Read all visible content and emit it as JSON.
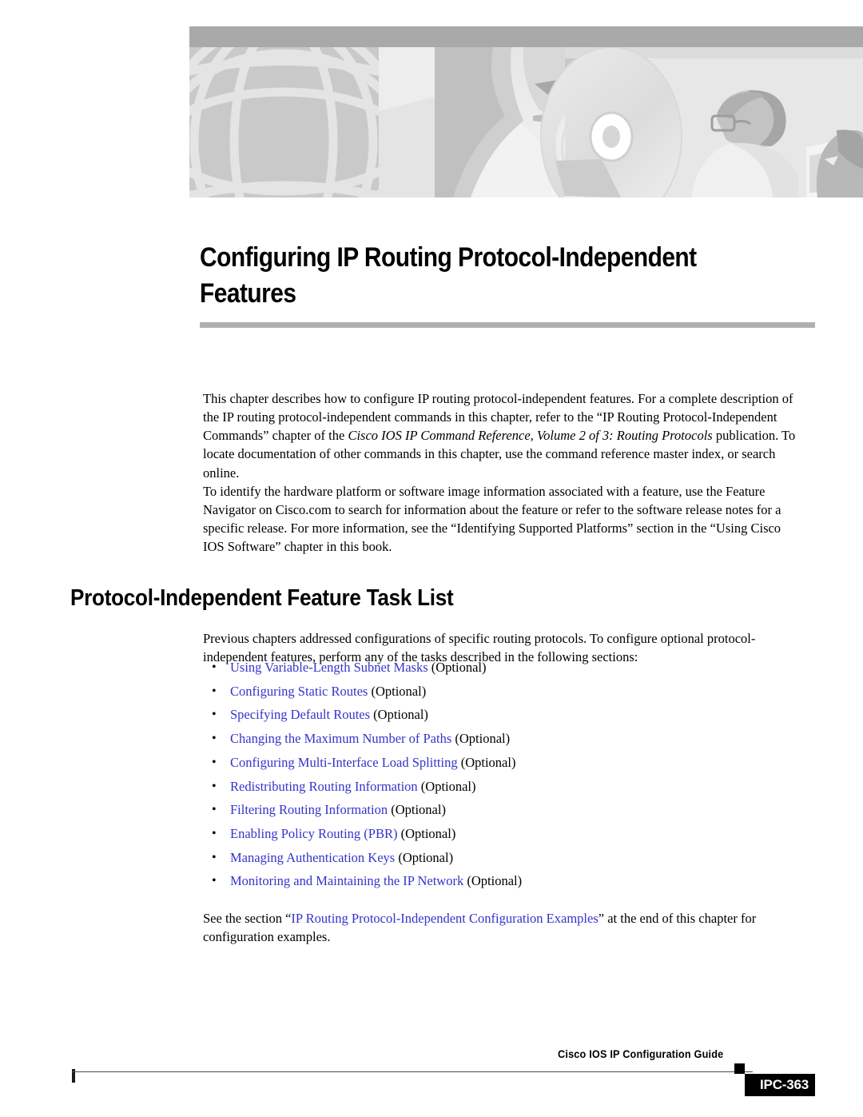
{
  "banner": {
    "alt": "cisco-chapter-banner-illustration",
    "elements": [
      "globe-wireframe",
      "face-profile",
      "compact-disc",
      "person-with-glasses-at-monitor",
      "person-silhouette"
    ],
    "colors": {
      "band_top": "#a9a9a9",
      "background": "#d3d3d3",
      "light": "#e8e8e8",
      "mid": "#c4c4c4"
    }
  },
  "chapter": {
    "title": "Configuring IP Routing Protocol-Independent Features",
    "rule_color": "#b0b0b0"
  },
  "intro": {
    "para1_a": "This chapter describes how to configure IP routing protocol-independent features. For a complete description of the IP routing protocol-independent commands in this chapter, refer to the “IP Routing Protocol-Independent Commands” chapter of the ",
    "para1_italic1": "Cisco IOS IP Command Reference, Volume 2 of 3: Routing Protocols",
    "para1_b": " publication. To locate documentation of other commands in this chapter, use the command reference master index, or search online.",
    "para2": "To identify the hardware platform or software image information associated with a feature, use the Feature Navigator on Cisco.com to search for information about the feature or refer to the software release notes for a specific release. For more information, see the “Identifying Supported Platforms” section in the “Using Cisco IOS Software” chapter in this book."
  },
  "section": {
    "heading": "Protocol-Independent Feature Task List",
    "intro": "Previous chapters addressed configurations of specific routing protocols. To configure optional protocol-independent features, perform any of the tasks described in the following sections:",
    "bullet_glyph": "•",
    "link_color": "#3333cc",
    "items": [
      {
        "link": "Using Variable-Length Subnet Masks",
        "suffix": " (Optional)"
      },
      {
        "link": "Configuring Static Routes",
        "suffix": " (Optional)"
      },
      {
        "link": "Specifying Default Routes",
        "suffix": " (Optional)"
      },
      {
        "link": "Changing the Maximum Number of Paths",
        "suffix": " (Optional)"
      },
      {
        "link": "Configuring Multi-Interface Load Splitting",
        "suffix": " (Optional)"
      },
      {
        "link": "Redistributing Routing Information",
        "suffix": " (Optional)"
      },
      {
        "link": "Filtering Routing Information",
        "suffix": " (Optional)"
      },
      {
        "link": "Enabling Policy Routing (PBR)",
        "suffix": " (Optional)"
      },
      {
        "link": "Managing Authentication Keys",
        "suffix": " (Optional)"
      },
      {
        "link": "Monitoring and Maintaining the IP Network",
        "suffix": " (Optional)"
      }
    ],
    "closing_a": "See the section “",
    "closing_link": "IP Routing Protocol-Independent Configuration Examples",
    "closing_b": "” at the end of this chapter for configuration examples."
  },
  "footer": {
    "guide_title": "Cisco IOS IP Configuration Guide",
    "page_number": "IPC-363"
  }
}
